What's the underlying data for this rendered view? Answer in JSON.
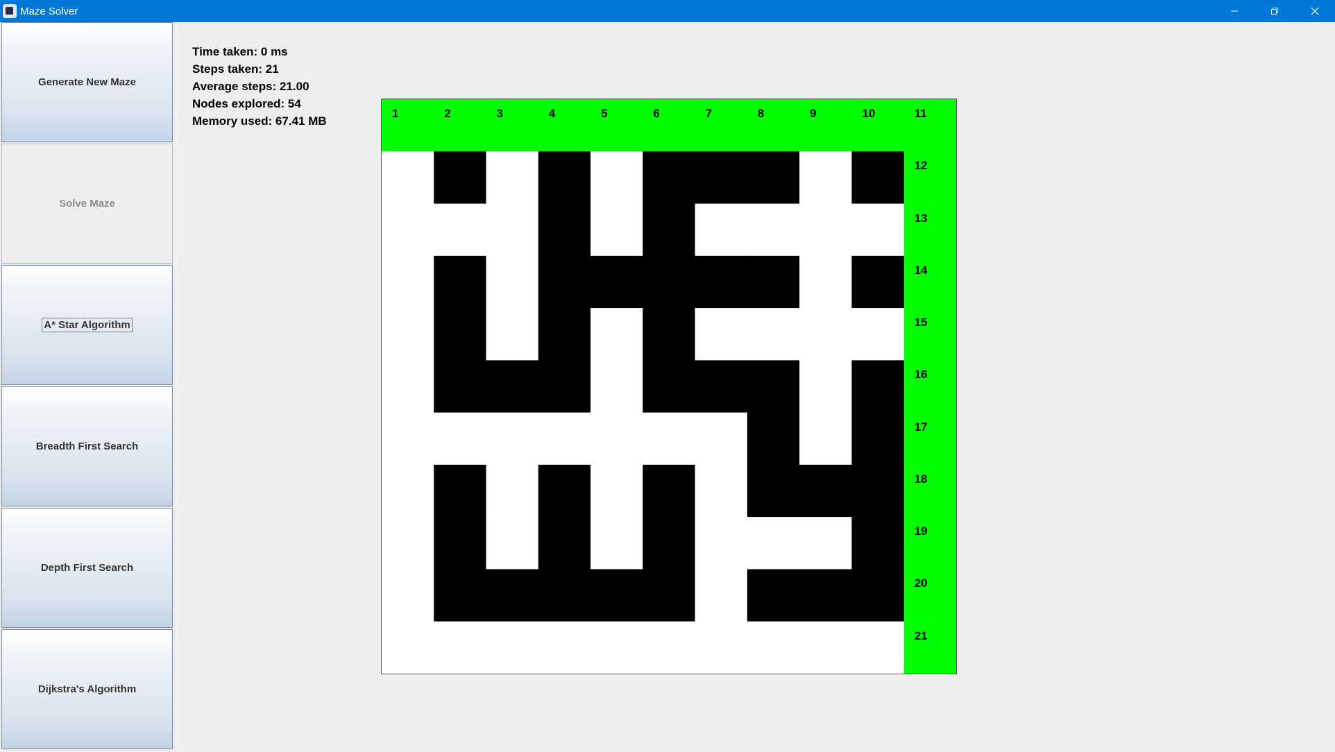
{
  "window": {
    "title": "Maze Solver",
    "controls": [
      "minimize-icon",
      "restore-icon",
      "close-icon"
    ]
  },
  "sidebar": {
    "buttons": [
      {
        "label": "Generate New Maze",
        "enabled": true
      },
      {
        "label": "Solve Maze",
        "enabled": false
      },
      {
        "label": "A* Star Algorithm",
        "enabled": true,
        "focused": true
      },
      {
        "label": "Breadth First Search",
        "enabled": true
      },
      {
        "label": "Depth First Search",
        "enabled": true
      },
      {
        "label": "Dijkstra's Algorithm",
        "enabled": true
      }
    ]
  },
  "stats": {
    "time": "Time taken: 0 ms",
    "steps": "Steps taken: 21",
    "average": "Average steps: 21.00",
    "nodes": "Nodes explored: 54",
    "memory": "Memory used: 67.41 MB"
  },
  "maze": {
    "rows": 11,
    "cols": 11,
    "legend": {
      "1": "wall",
      "0": "open",
      "2": "path"
    },
    "grid": [
      [
        2,
        2,
        2,
        2,
        2,
        2,
        2,
        2,
        2,
        2,
        2
      ],
      [
        0,
        1,
        0,
        1,
        0,
        1,
        1,
        1,
        0,
        1,
        2
      ],
      [
        0,
        0,
        0,
        1,
        0,
        1,
        0,
        0,
        0,
        0,
        2
      ],
      [
        0,
        1,
        0,
        1,
        1,
        1,
        1,
        1,
        0,
        1,
        2
      ],
      [
        0,
        1,
        0,
        1,
        0,
        1,
        0,
        0,
        0,
        0,
        2
      ],
      [
        0,
        1,
        1,
        1,
        0,
        1,
        1,
        1,
        0,
        1,
        2
      ],
      [
        0,
        0,
        0,
        0,
        0,
        0,
        0,
        1,
        0,
        1,
        2
      ],
      [
        0,
        1,
        0,
        1,
        0,
        1,
        0,
        1,
        1,
        1,
        2
      ],
      [
        0,
        1,
        0,
        1,
        0,
        1,
        0,
        0,
        0,
        1,
        2
      ],
      [
        0,
        1,
        1,
        1,
        1,
        1,
        0,
        1,
        1,
        1,
        2
      ],
      [
        0,
        0,
        0,
        0,
        0,
        0,
        0,
        0,
        0,
        0,
        2
      ]
    ],
    "path_labels": [
      "1",
      "2",
      "3",
      "4",
      "5",
      "6",
      "7",
      "8",
      "9",
      "10",
      "11",
      "12",
      "13",
      "14",
      "15",
      "16",
      "17",
      "18",
      "19",
      "20",
      "21"
    ],
    "colors": {
      "wall": "#000000",
      "open": "#ffffff",
      "path": "#00ff00"
    }
  }
}
